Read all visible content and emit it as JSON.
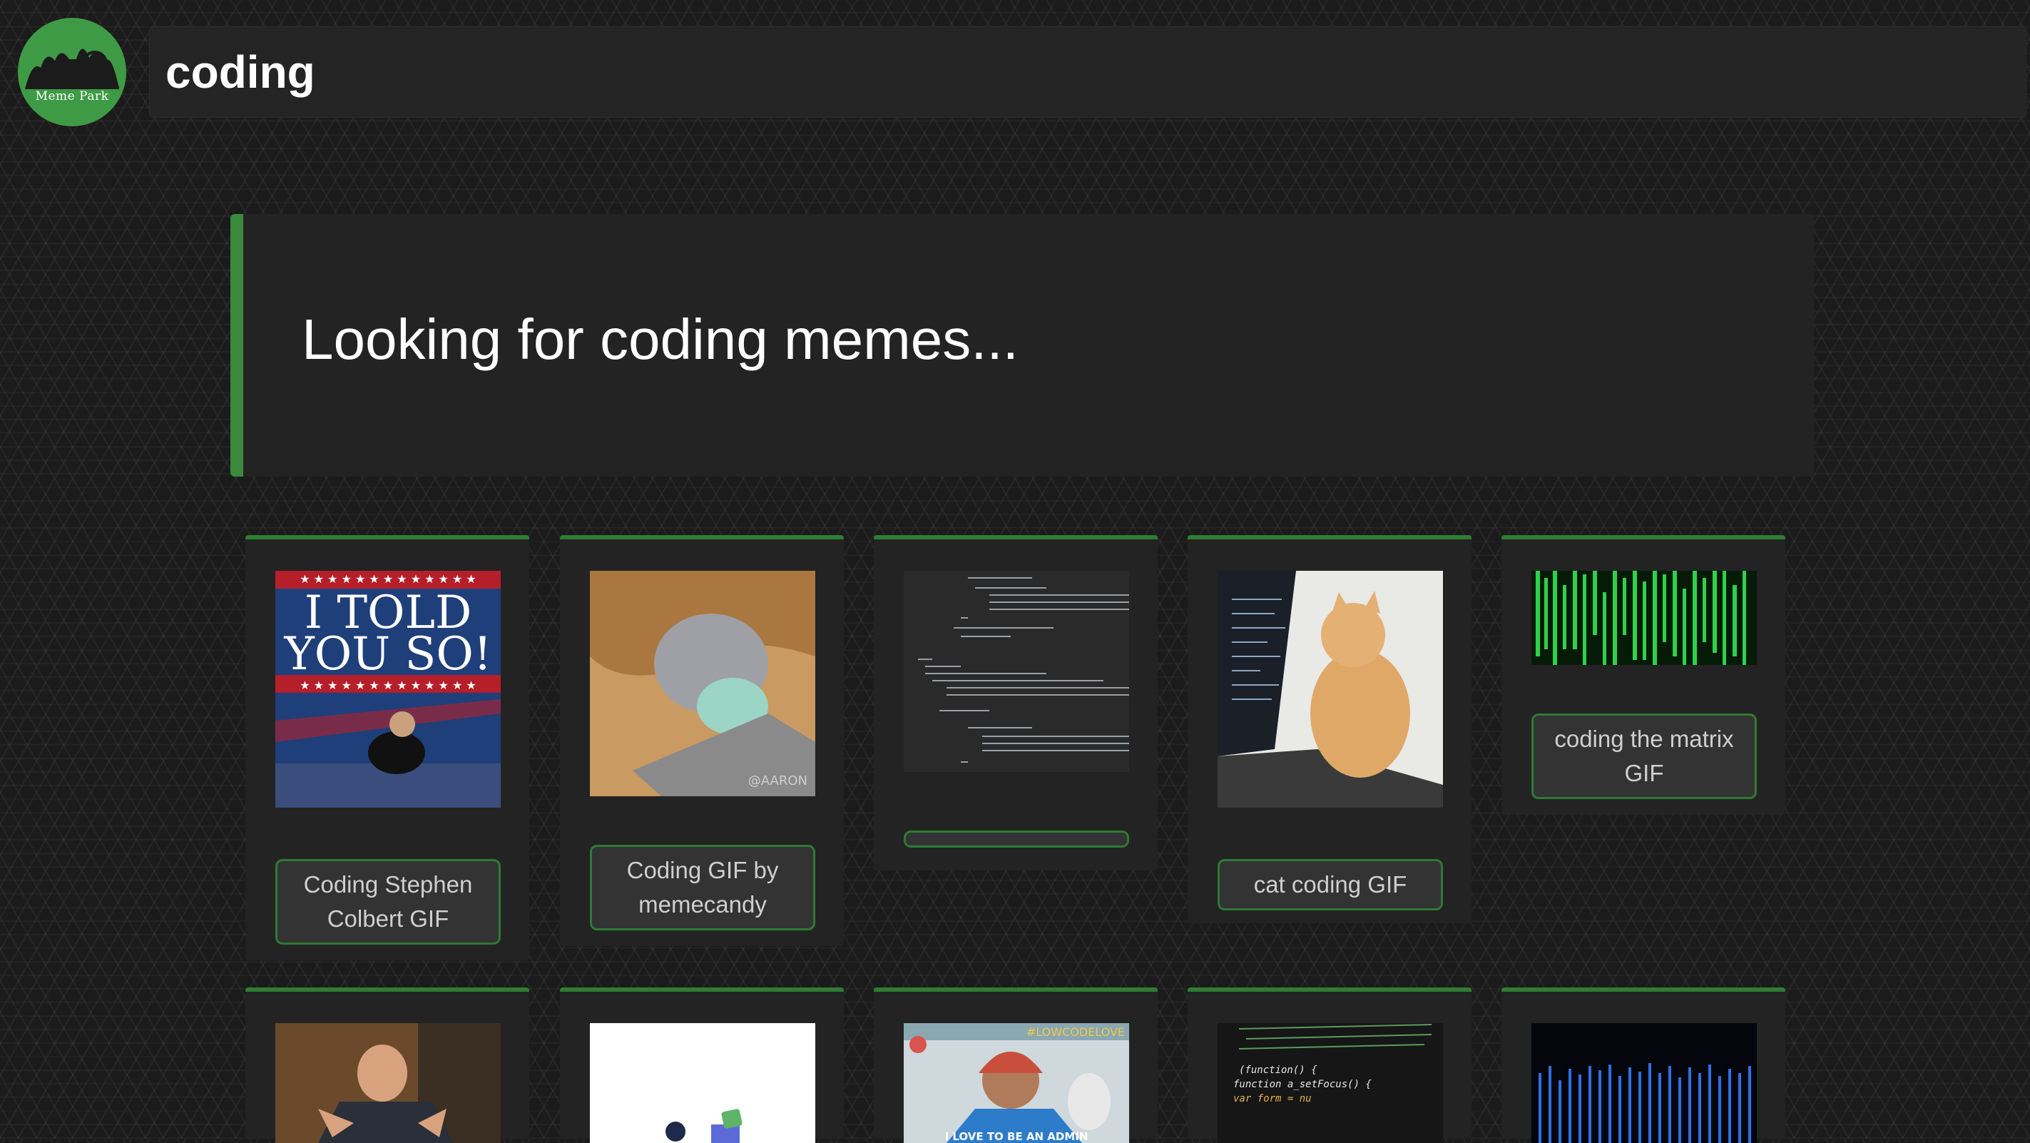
{
  "logo": {
    "text": "Meme Park",
    "color": "#3f9a45"
  },
  "search": {
    "value": "coding"
  },
  "banner": {
    "title": "Looking for coding memes...",
    "accent": "#3a8a3d"
  },
  "cards_row1": [
    {
      "caption": "Coding Stephen Colbert GIF",
      "image": "i-told-you-so-gif"
    },
    {
      "caption": "Coding GIF by memecandy",
      "image": "cat-typing-laptop-gif"
    },
    {
      "caption": "",
      "image": "code-editor-gif"
    },
    {
      "caption": "cat coding GIF",
      "image": "kitten-laptop-gif"
    },
    {
      "caption": "coding the matrix GIF",
      "image": "matrix-rain-gif"
    }
  ],
  "cards_row2": [
    {
      "image": "man-typing-gif"
    },
    {
      "image": "illustration-gif"
    },
    {
      "image": "admin-woman-gif",
      "overlay_text": "I LOVE TO BE AN ADMIN",
      "tag": "#LOWCODELOVE"
    },
    {
      "image": "javascript-code-gif"
    },
    {
      "image": "blue-matrix-gif"
    }
  ],
  "image_text": {
    "told_you_so": [
      "I TOLD",
      "YOU SO!"
    ],
    "watermark": "@AARON",
    "code_lines": [
      "(function() {",
      "function a_setFocus() {",
      "var form = nu"
    ]
  }
}
